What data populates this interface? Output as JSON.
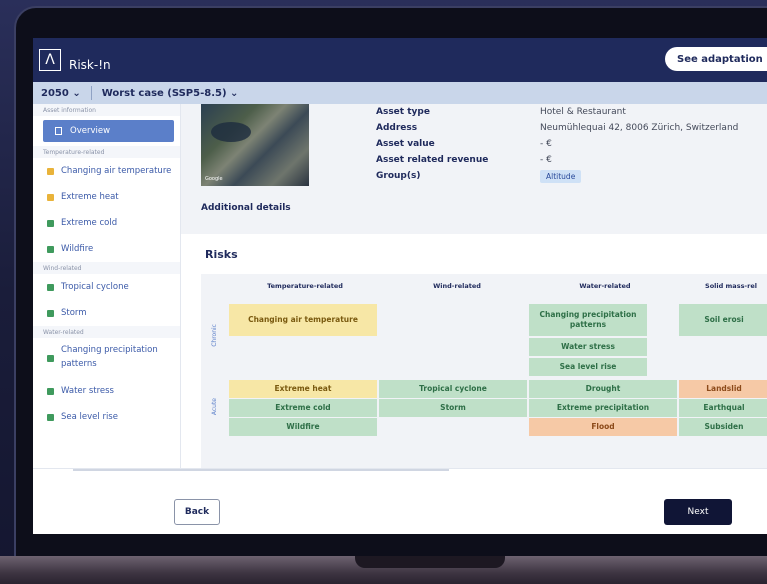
{
  "app": {
    "name": "Risk-!n",
    "logo": "Λ"
  },
  "header": {
    "adapt_button": "See adaptation me"
  },
  "scenario": {
    "year": "2050 ⌄",
    "case": "Worst case (SSP5-8.5) ⌄"
  },
  "sidebar": {
    "section_asset": "Asset information",
    "overview": "Overview",
    "section_temp": "Temperature-related",
    "temp_items": [
      "Changing air temperature",
      "Extreme heat",
      "Extreme cold",
      "Wildfire"
    ],
    "section_wind": "Wind-related",
    "wind_items": [
      "Tropical cyclone",
      "Storm"
    ],
    "section_water": "Water-related",
    "water_items": [
      "Changing precipitation patterns",
      "Water stress",
      "Sea level rise"
    ]
  },
  "asset": {
    "rows": [
      {
        "k": "Asset type",
        "v": "Hotel & Restaurant"
      },
      {
        "k": "Address",
        "v": "Neumühlequai 42, 8006 Zürich, Switzerland"
      },
      {
        "k": "Asset value",
        "v": "- €"
      },
      {
        "k": "Asset related revenue",
        "v": "- €"
      },
      {
        "k": "Group(s)",
        "v": "Altitude"
      }
    ],
    "additional_details": "Additional details",
    "thumb_tag": "Google"
  },
  "risks": {
    "title": "Risks",
    "columns": [
      "Temperature-related",
      "Wind-related",
      "Water-related",
      "Solid mass-rel"
    ],
    "rows": [
      "Chronic",
      "Acute"
    ],
    "chronic_temp": "Changing air temperature",
    "chronic_water": [
      "Changing precipitation patterns",
      "Water stress",
      "Sea level rise"
    ],
    "chronic_solid": "Soil erosi",
    "acute_temp": [
      "Extreme heat",
      "Extreme cold",
      "Wildfire"
    ],
    "acute_wind": [
      "Tropical cyclone",
      "Storm"
    ],
    "acute_water": [
      "Drought",
      "Extreme precipitation",
      "Flood"
    ],
    "acute_solid": [
      "Landslid",
      "Earthqual",
      "Subsiden"
    ]
  },
  "footer": {
    "back": "Back",
    "next": "Next"
  }
}
